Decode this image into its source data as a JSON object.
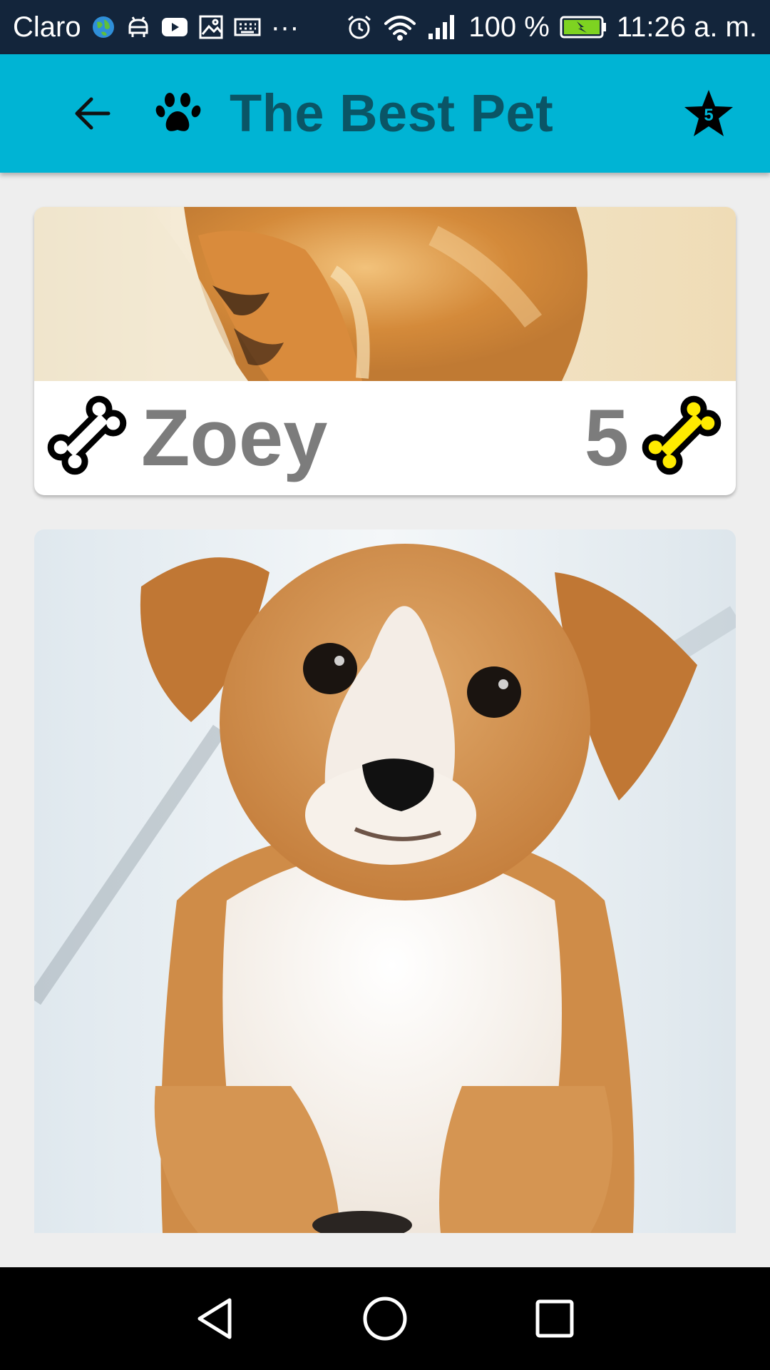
{
  "status_bar": {
    "carrier": "Claro",
    "more": "···",
    "battery_percent": "100 %",
    "time": "11:26 a. m.",
    "icons": [
      "globe-icon",
      "android-icon",
      "youtube-icon",
      "image-icon",
      "keyboard-icon",
      "alarm-icon",
      "wifi-icon",
      "signal-icon",
      "battery-charging-icon"
    ]
  },
  "app_bar": {
    "title": "The Best Pet",
    "back_icon": "arrow-left-icon",
    "logo_icon": "paw-icon",
    "favorites": {
      "icon": "star-icon",
      "count": "5"
    }
  },
  "pets": [
    {
      "name": "Zoey",
      "rating": "5",
      "photo": "puppy-paw-photo",
      "rank_icon": "bone-icon",
      "like_icon": "yellow-bone-icon",
      "like_color": "#ffeb00"
    },
    {
      "photo": "puppy-photo"
    }
  ],
  "nav_bar": {
    "buttons": [
      "back-triangle-icon",
      "home-circle-icon",
      "recents-square-icon"
    ]
  },
  "colors": {
    "status_bar": "#13253b",
    "app_bar": "#00b4d4",
    "title_text": "#0a5566",
    "background": "#eeeeee",
    "name_text": "#7c7c7c"
  }
}
